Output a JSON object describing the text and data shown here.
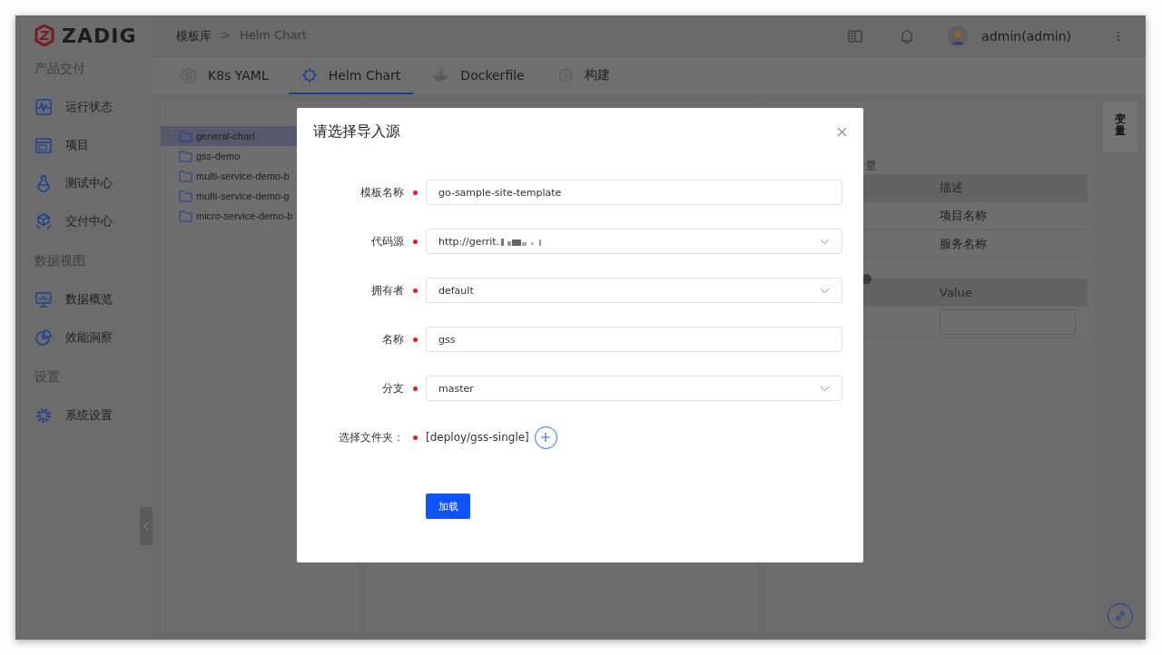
{
  "sidebar": {
    "logo": "ZADIG",
    "sections": [
      {
        "title": "产品交付",
        "items": [
          {
            "label": "运行状态",
            "kind": "pulse"
          },
          {
            "label": "项目",
            "kind": "project"
          },
          {
            "label": "测试中心",
            "kind": "flask"
          },
          {
            "label": "交付中心",
            "kind": "box"
          }
        ]
      },
      {
        "title": "数据视图",
        "items": [
          {
            "label": "数据概览",
            "kind": "monitor"
          },
          {
            "label": "效能洞察",
            "kind": "pie"
          }
        ]
      },
      {
        "title": "设置",
        "items": [
          {
            "label": "系统设置",
            "kind": "gear"
          }
        ]
      }
    ]
  },
  "header": {
    "breadcrumb": [
      "模板库",
      "Helm Chart"
    ],
    "separator": ">",
    "user": "admin(admin)"
  },
  "tabs": [
    {
      "label": "K8s YAML",
      "kind": "k8s",
      "selected": false
    },
    {
      "label": "Helm Chart",
      "kind": "helm",
      "selected": true
    },
    {
      "label": "Dockerfile",
      "kind": "docker",
      "selected": false
    },
    {
      "label": "构建",
      "kind": "cube",
      "selected": false
    }
  ],
  "tree": [
    {
      "label": "general-chart",
      "selected": true
    },
    {
      "label": "gss-demo",
      "selected": false
    },
    {
      "label": "multi-service-demo-b",
      "selected": false
    },
    {
      "label": "multi-service-demo-g",
      "selected": false
    },
    {
      "label": "micro-service-demo-b",
      "selected": false
    }
  ],
  "variables": {
    "title": "量",
    "header": "描述",
    "rows": [
      "项目名称",
      "服务名称"
    ],
    "value_header": "Value"
  },
  "side_tab": "变量",
  "modal": {
    "title": "请选择导入源",
    "fields": [
      {
        "label": "模板名称",
        "kind": "input",
        "value": "go-sample-site-template",
        "required": true
      },
      {
        "label": "代码源",
        "kind": "select",
        "value": "http://gerrit.",
        "redacted": true,
        "required": true
      },
      {
        "label": "拥有者",
        "kind": "select",
        "value": "default",
        "required": true
      },
      {
        "label": "名称",
        "kind": "input",
        "value": "gss",
        "required": true
      },
      {
        "label": "分支",
        "kind": "select",
        "value": "master",
        "required": true
      }
    ],
    "folder": {
      "label": "选择文件夹：",
      "value": "[deploy/gss-single]",
      "required": true
    },
    "submit": "加载"
  }
}
